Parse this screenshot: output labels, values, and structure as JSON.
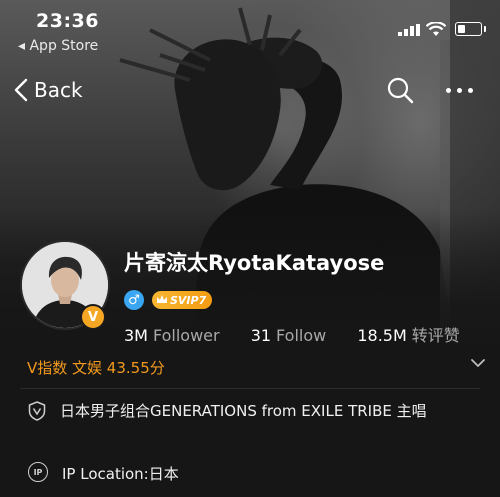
{
  "status_bar": {
    "time": "23:36",
    "back_app_label": "◂ App Store",
    "icons": [
      "signal-icon",
      "wifi-icon",
      "battery-icon"
    ]
  },
  "nav": {
    "back_label": "Back",
    "icons": [
      "back-chevron-icon",
      "search-icon",
      "more-icon"
    ]
  },
  "profile": {
    "name": "片寄涼太RyotaKatayose",
    "verified_badge": "V",
    "vip_label": "SVIP7",
    "gender_symbol": "♂",
    "stats": [
      {
        "value": "3M",
        "label": "Follower"
      },
      {
        "value": "31",
        "label": "Follow"
      },
      {
        "value": "18.5M",
        "label": "转评赞"
      }
    ],
    "v_index": "V指数 文娱 43.55分",
    "bio": "日本男子组合GENERATIONS from EXILE TRIBE 主唱",
    "ip_location": "IP Location:日本"
  },
  "colors": {
    "accent_orange": "#f39a1d",
    "vip_gold": "#f5a623",
    "gender_blue": "#3aa6f2",
    "background": "#161616"
  }
}
